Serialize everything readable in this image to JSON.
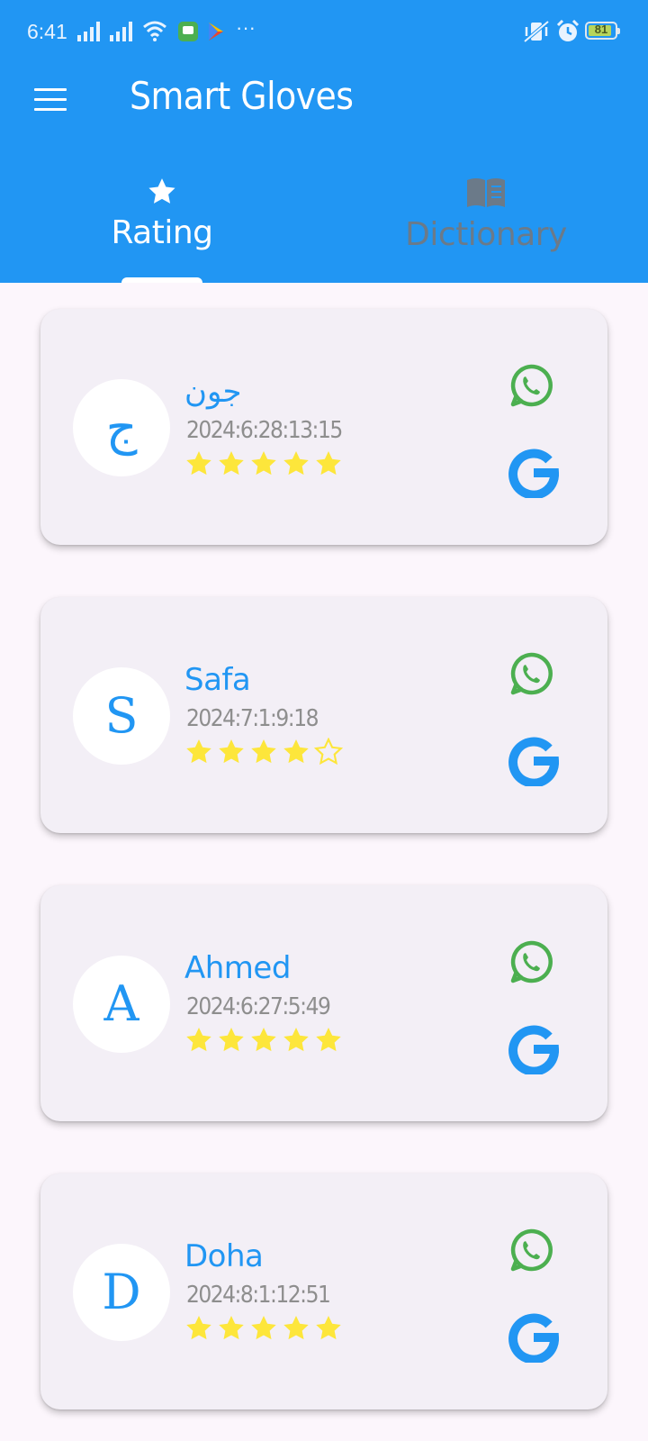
{
  "status_bar": {
    "time": "6:41",
    "more": "···",
    "battery": "81"
  },
  "app_bar": {
    "title": "Smart Gloves"
  },
  "tabs": [
    {
      "label": "Rating",
      "icon": "star-icon",
      "selected": true
    },
    {
      "label": "Dictionary",
      "icon": "book-icon",
      "selected": false
    }
  ],
  "colors": {
    "primary": "#2196f3",
    "star": "#fde63b",
    "whatsapp": "#4caf50",
    "google": "#2196f3"
  },
  "ratings": [
    {
      "initial": "ج",
      "name": "جون",
      "date": "2024:6:28:13:15",
      "stars": 5
    },
    {
      "initial": "S",
      "name": "Safa",
      "date": "2024:7:1:9:18",
      "stars": 4
    },
    {
      "initial": "A",
      "name": "Ahmed",
      "date": "2024:6:27:5:49",
      "stars": 5
    },
    {
      "initial": "D",
      "name": "Doha",
      "date": "2024:8:1:12:51",
      "stars": 5
    }
  ]
}
